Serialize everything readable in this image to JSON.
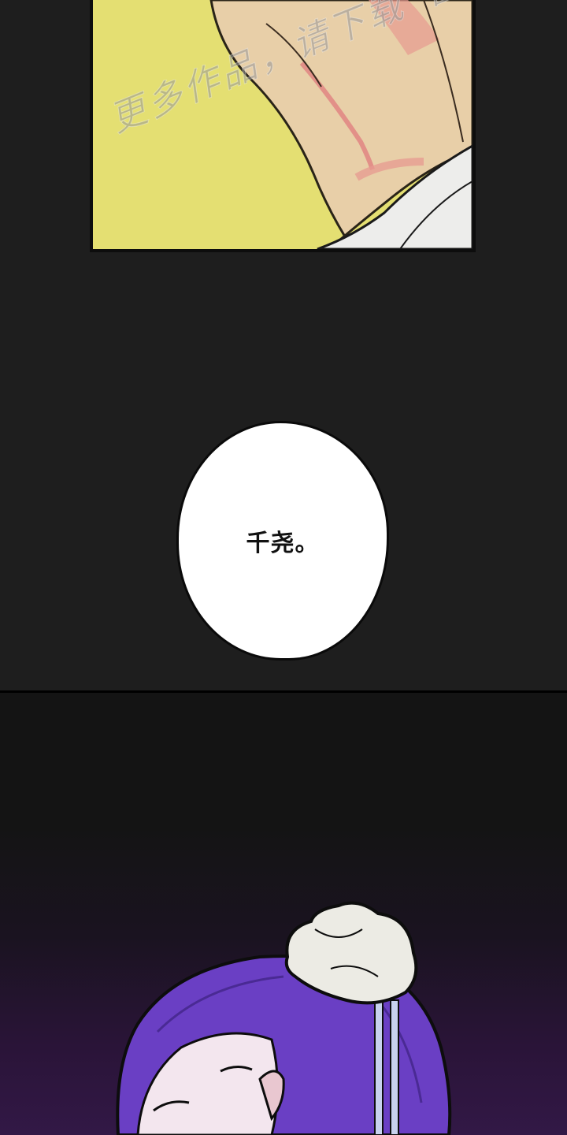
{
  "watermark": {
    "text": "更多作品，请下载“番木瓜"
  },
  "dialogue": {
    "bubble_text": "千尧。"
  },
  "colors": {
    "background": "#1e1e1e",
    "panel_top_bg": "#e4df72",
    "skin": "#e8cfa8",
    "hair_purple": "#6a3fc4",
    "bubble_fill": "#ffffff",
    "text": "#111111"
  }
}
